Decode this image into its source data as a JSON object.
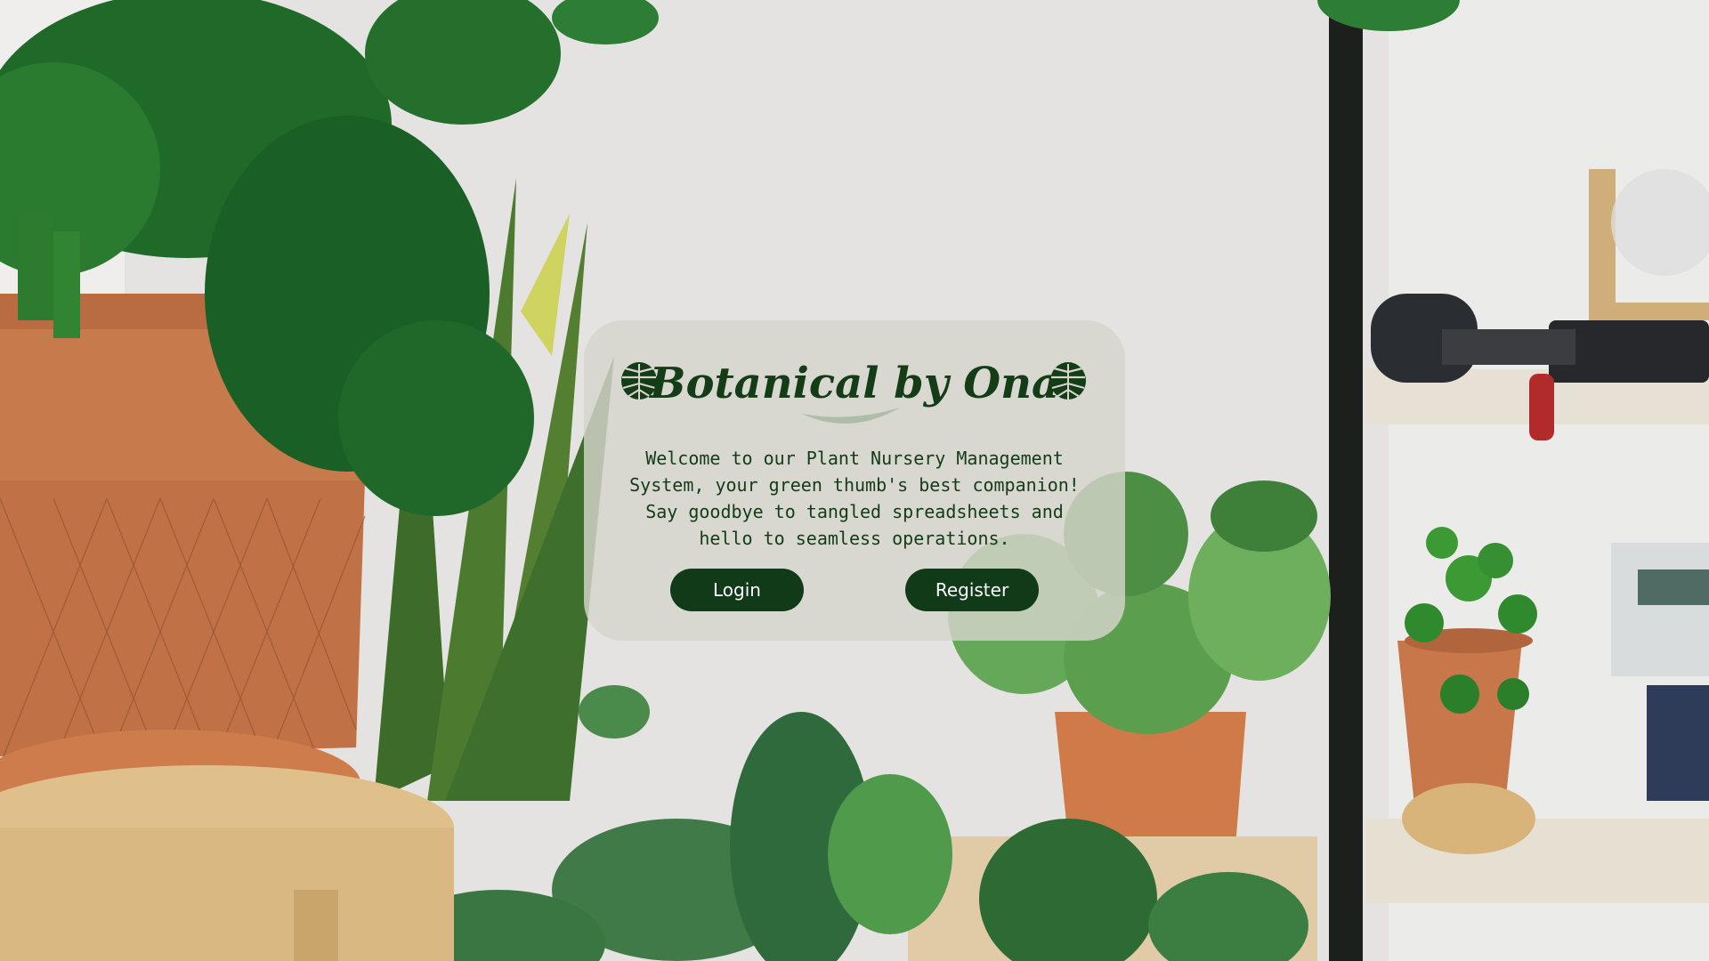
{
  "app": {
    "title": "Botanical by Ona",
    "welcome_text": "Welcome to our Plant Nursery Management\nSystem, your green thumb's best companion!\nSay goodbye to tangled spreadsheets and\nhello to seamless operations.",
    "login_label": "Login",
    "register_label": "Register"
  },
  "icons": {
    "title_left": "monstera-leaf-icon",
    "title_right": "monstera-leaf-icon"
  },
  "colors": {
    "brand_green": "#133c17",
    "button_bg": "#103a18",
    "button_text": "#ffffff",
    "card_bg": "#d6d4cc"
  },
  "background": {
    "description_icon": "plant-room-photo"
  }
}
